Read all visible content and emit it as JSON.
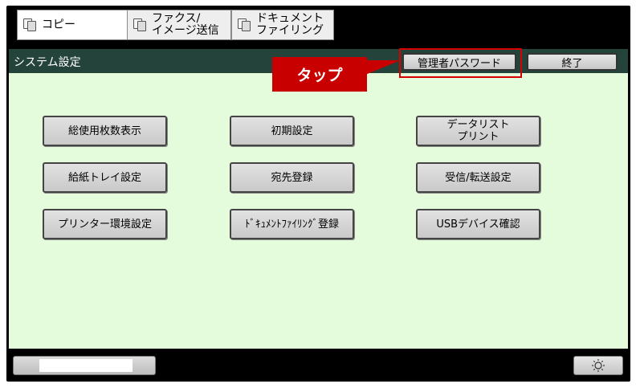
{
  "tabs": [
    {
      "label": "コピー",
      "icon": "copy-icon"
    },
    {
      "label": "ファクス/\nイメージ送信",
      "icon": "fax-icon"
    },
    {
      "label": "ドキュメント\nファイリング",
      "icon": "document-filing-icon"
    }
  ],
  "titlebar": {
    "title": "システム設定",
    "admin_password_label": "管理者パスワード",
    "exit_label": "終了"
  },
  "main": {
    "buttons": [
      {
        "label": "総使用枚数表示"
      },
      {
        "label": "初期設定"
      },
      {
        "label": "データリスト\nプリント"
      },
      {
        "label": "給紙トレイ設定"
      },
      {
        "label": "宛先登録"
      },
      {
        "label": "受信/転送設定"
      },
      {
        "label": "プリンター環境設定"
      },
      {
        "label": "ﾄﾞｷｭﾒﾝﾄﾌｧｲﾘﾝｸﾞ登録"
      },
      {
        "label": "USBデバイス確認"
      }
    ]
  },
  "annotation": {
    "callout_label": "タップ",
    "color": "#c80000"
  },
  "bottom": {
    "brightness_icon": "brightness-icon"
  }
}
